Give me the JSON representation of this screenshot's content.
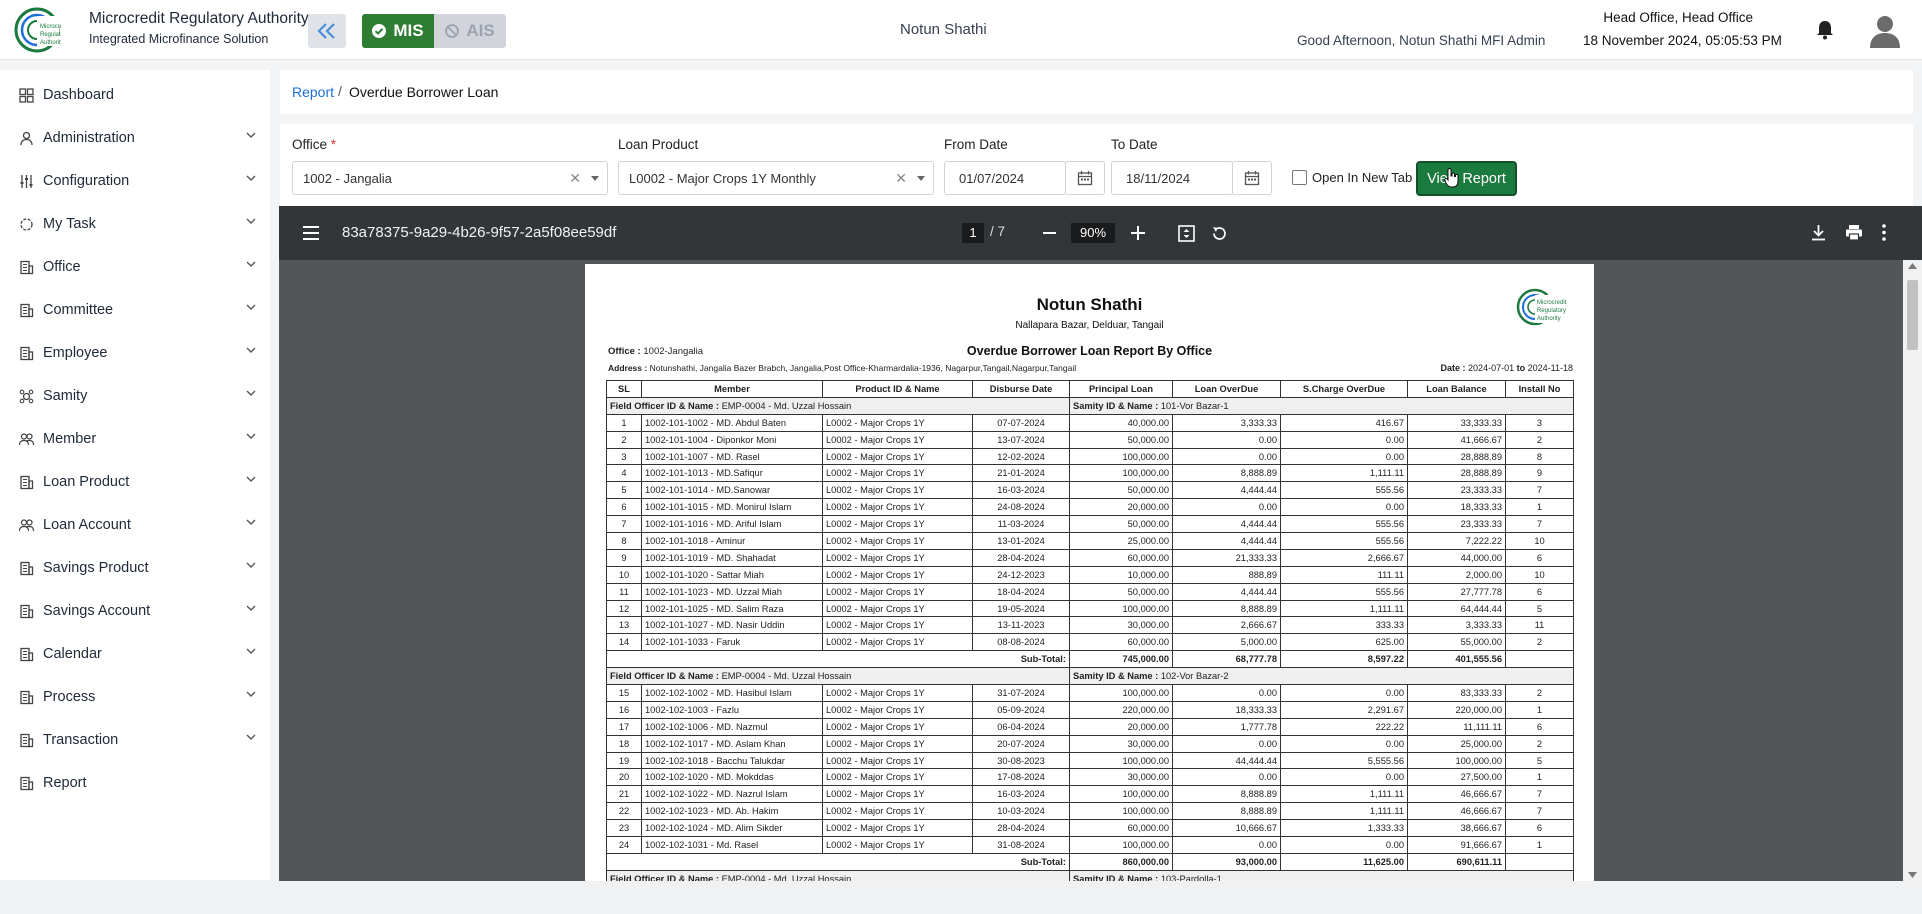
{
  "header": {
    "org_name": "Microcredit Regulatory Authority",
    "org_sub": "Integrated Microfinance Solution",
    "mis_label": "MIS",
    "ais_label": "AIS",
    "center_title": "Notun Shathi",
    "office": "Head Office, Head Office",
    "greeting": "Good Afternoon, Notun Shathi MFI Admin",
    "datetime": "18 November 2024, 05:05:53 PM",
    "accent": "#2e7d32"
  },
  "sidebar": {
    "items": [
      {
        "label": "Dashboard",
        "icon": "dashboard-icon",
        "expandable": false
      },
      {
        "label": "Administration",
        "icon": "admin-icon",
        "expandable": true
      },
      {
        "label": "Configuration",
        "icon": "sliders-icon",
        "expandable": true
      },
      {
        "label": "My Task",
        "icon": "task-icon",
        "expandable": true
      },
      {
        "label": "Office",
        "icon": "building-icon",
        "expandable": true
      },
      {
        "label": "Committee",
        "icon": "building-icon",
        "expandable": true
      },
      {
        "label": "Employee",
        "icon": "building-icon",
        "expandable": true
      },
      {
        "label": "Samity",
        "icon": "group-icon",
        "expandable": true
      },
      {
        "label": "Member",
        "icon": "people-icon",
        "expandable": true
      },
      {
        "label": "Loan Product",
        "icon": "building-icon",
        "expandable": true
      },
      {
        "label": "Loan Account",
        "icon": "people-icon",
        "expandable": true
      },
      {
        "label": "Savings Product",
        "icon": "building-icon",
        "expandable": true
      },
      {
        "label": "Savings Account",
        "icon": "building-icon",
        "expandable": true
      },
      {
        "label": "Calendar",
        "icon": "building-icon",
        "expandable": true
      },
      {
        "label": "Process",
        "icon": "building-icon",
        "expandable": true
      },
      {
        "label": "Transaction",
        "icon": "building-icon",
        "expandable": true
      },
      {
        "label": "Report",
        "icon": "building-icon",
        "expandable": false
      }
    ]
  },
  "breadcrumb": {
    "root": "Report",
    "sep": "/",
    "current": "Overdue Borrower Loan"
  },
  "filters": {
    "office_label": "Office",
    "office_required": "*",
    "office_value": "1002 - Jangalia",
    "product_label": "Loan Product",
    "product_value": "L0002 - Major Crops 1Y Monthly",
    "from_label": "From Date",
    "from_value": "01/07/2024",
    "to_label": "To Date",
    "to_value": "18/11/2024",
    "new_tab_label": "Open In New Tab",
    "view_button": "View Report"
  },
  "pdf": {
    "doc_name": "83a78375-9a29-4b26-9f57-2a5f08ee59df",
    "page": "1",
    "page_total": "/ 7",
    "zoom": "90%"
  },
  "report": {
    "org": "Notun Shathi",
    "address": "Nallapara Bazar, Delduar, Tangail",
    "title": "Overdue Borrower Loan Report By Office",
    "office_label": "Office :",
    "office_value": "1002-Jangalia",
    "address_label": "Address :",
    "address_value": "Notunshathi, Jangalia Bazer Brabch, Jangalia,Post Office-Kharmardalia-1936, Nagarpur,Tangail,Nagarpur,Tangail",
    "date_label": "Date :",
    "date_from": "2024-07-01",
    "date_to_word": "to",
    "date_to": "2024-11-18",
    "columns": [
      "SL",
      "Member",
      "Product ID & Name",
      "Disburse Date",
      "Principal Loan",
      "Loan OverDue",
      "S.Charge OverDue",
      "Loan Balance",
      "Install No"
    ],
    "groups": [
      {
        "fo_label": "Field Officer ID & Name :",
        "fo_value": "EMP-0004 - Md. Uzzal Hossain",
        "samity_label": "Samity ID & Name :",
        "samity_value": "101-Vor Bazar-1",
        "rows": [
          [
            "1",
            "1002-101-1002 - MD. Abdul Baten",
            "L0002 - Major Crops 1Y",
            "07-07-2024",
            "40,000.00",
            "3,333.33",
            "416.67",
            "33,333.33",
            "3"
          ],
          [
            "2",
            "1002-101-1004 - Diponkor Moni",
            "L0002 - Major Crops 1Y",
            "13-07-2024",
            "50,000.00",
            "0.00",
            "0.00",
            "41,666.67",
            "2"
          ],
          [
            "3",
            "1002-101-1007 - MD. Rasel",
            "L0002 - Major Crops 1Y",
            "12-02-2024",
            "100,000.00",
            "0.00",
            "0.00",
            "28,888.89",
            "8"
          ],
          [
            "4",
            "1002-101-1013 - MD.Safiqur",
            "L0002 - Major Crops 1Y",
            "21-01-2024",
            "100,000.00",
            "8,888.89",
            "1,111.11",
            "28,888.89",
            "9"
          ],
          [
            "5",
            "1002-101-1014 - MD.Sanowar",
            "L0002 - Major Crops 1Y",
            "16-03-2024",
            "50,000.00",
            "4,444.44",
            "555.56",
            "23,333.33",
            "7"
          ],
          [
            "6",
            "1002-101-1015 - MD. Monirul Islam",
            "L0002 - Major Crops 1Y",
            "24-08-2024",
            "20,000.00",
            "0.00",
            "0.00",
            "18,333.33",
            "1"
          ],
          [
            "7",
            "1002-101-1016 - MD. Ariful Islam",
            "L0002 - Major Crops 1Y",
            "11-03-2024",
            "50,000.00",
            "4,444.44",
            "555.56",
            "23,333.33",
            "7"
          ],
          [
            "8",
            "1002-101-1018 - Aminur",
            "L0002 - Major Crops 1Y",
            "13-01-2024",
            "25,000.00",
            "4,444.44",
            "555.56",
            "7,222.22",
            "10"
          ],
          [
            "9",
            "1002-101-1019 - MD. Shahadat",
            "L0002 - Major Crops 1Y",
            "28-04-2024",
            "60,000.00",
            "21,333.33",
            "2,666.67",
            "44,000.00",
            "6"
          ],
          [
            "10",
            "1002-101-1020 - Sattar Miah",
            "L0002 - Major Crops 1Y",
            "24-12-2023",
            "10,000.00",
            "888.89",
            "111.11",
            "2,000.00",
            "10"
          ],
          [
            "11",
            "1002-101-1023 - MD. Uzzal Miah",
            "L0002 - Major Crops 1Y",
            "18-04-2024",
            "50,000.00",
            "4,444.44",
            "555.56",
            "27,777.78",
            "6"
          ],
          [
            "12",
            "1002-101-1025 - MD. Salim Raza",
            "L0002 - Major Crops 1Y",
            "19-05-2024",
            "100,000.00",
            "8,888.89",
            "1,111.11",
            "64,444.44",
            "5"
          ],
          [
            "13",
            "1002-101-1027 - MD. Nasir Uddin",
            "L0002 - Major Crops 1Y",
            "13-11-2023",
            "30,000.00",
            "2,666.67",
            "333.33",
            "3,333.33",
            "11"
          ],
          [
            "14",
            "1002-101-1033 - Faruk",
            "L0002 - Major Crops 1Y",
            "08-08-2024",
            "60,000.00",
            "5,000.00",
            "625.00",
            "55,000.00",
            "2"
          ]
        ],
        "subtotal": [
          "Sub-Total:",
          "745,000.00",
          "68,777.78",
          "8,597.22",
          "401,555.56",
          ""
        ]
      },
      {
        "fo_label": "Field Officer ID & Name :",
        "fo_value": "EMP-0004 - Md. Uzzal Hossain",
        "samity_label": "Samity ID & Name :",
        "samity_value": "102-Vor Bazar-2",
        "rows": [
          [
            "15",
            "1002-102-1002 - MD. Hasibul Islam",
            "L0002 - Major Crops 1Y",
            "31-07-2024",
            "100,000.00",
            "0.00",
            "0.00",
            "83,333.33",
            "2"
          ],
          [
            "16",
            "1002-102-1003 - Fazlu",
            "L0002 - Major Crops 1Y",
            "05-09-2024",
            "220,000.00",
            "18,333.33",
            "2,291.67",
            "220,000.00",
            "1"
          ],
          [
            "17",
            "1002-102-1006 - MD. Nazmul",
            "L0002 - Major Crops 1Y",
            "06-04-2024",
            "20,000.00",
            "1,777.78",
            "222.22",
            "11,111.11",
            "6"
          ],
          [
            "18",
            "1002-102-1017 - MD. Aslam Khan",
            "L0002 - Major Crops 1Y",
            "20-07-2024",
            "30,000.00",
            "0.00",
            "0.00",
            "25,000.00",
            "2"
          ],
          [
            "19",
            "1002-102-1018 - Bacchu Talukdar",
            "L0002 - Major Crops 1Y",
            "30-08-2023",
            "100,000.00",
            "44,444.44",
            "5,555.56",
            "100,000.00",
            "5"
          ],
          [
            "20",
            "1002-102-1020 - MD. Mokddas",
            "L0002 - Major Crops 1Y",
            "17-08-2024",
            "30,000.00",
            "0.00",
            "0.00",
            "27,500.00",
            "1"
          ],
          [
            "21",
            "1002-102-1022 - MD. Nazrul Islam",
            "L0002 - Major Crops 1Y",
            "16-03-2024",
            "100,000.00",
            "8,888.89",
            "1,111.11",
            "46,666.67",
            "7"
          ],
          [
            "22",
            "1002-102-1023 - MD. Ab. Hakim",
            "L0002 - Major Crops 1Y",
            "10-03-2024",
            "100,000.00",
            "8,888.89",
            "1,111.11",
            "46,666.67",
            "7"
          ],
          [
            "23",
            "1002-102-1024 - MD. Alim Sikder",
            "L0002 - Major Crops 1Y",
            "28-04-2024",
            "60,000.00",
            "10,666.67",
            "1,333.33",
            "38,666.67",
            "6"
          ],
          [
            "24",
            "1002-102-1031 - Md. Rasel",
            "L0002 - Major Crops 1Y",
            "31-08-2024",
            "100,000.00",
            "0.00",
            "0.00",
            "91,666.67",
            "1"
          ]
        ],
        "subtotal": [
          "Sub-Total:",
          "860,000.00",
          "93,000.00",
          "11,625.00",
          "690,611.11",
          ""
        ]
      },
      {
        "fo_label": "Field Officer ID & Name :",
        "fo_value": "EMP-0004 - Md. Uzzal Hossain",
        "samity_label": "Samity ID & Name :",
        "samity_value": "103-Pardolla-1",
        "rows": [],
        "subtotal": null
      }
    ]
  }
}
